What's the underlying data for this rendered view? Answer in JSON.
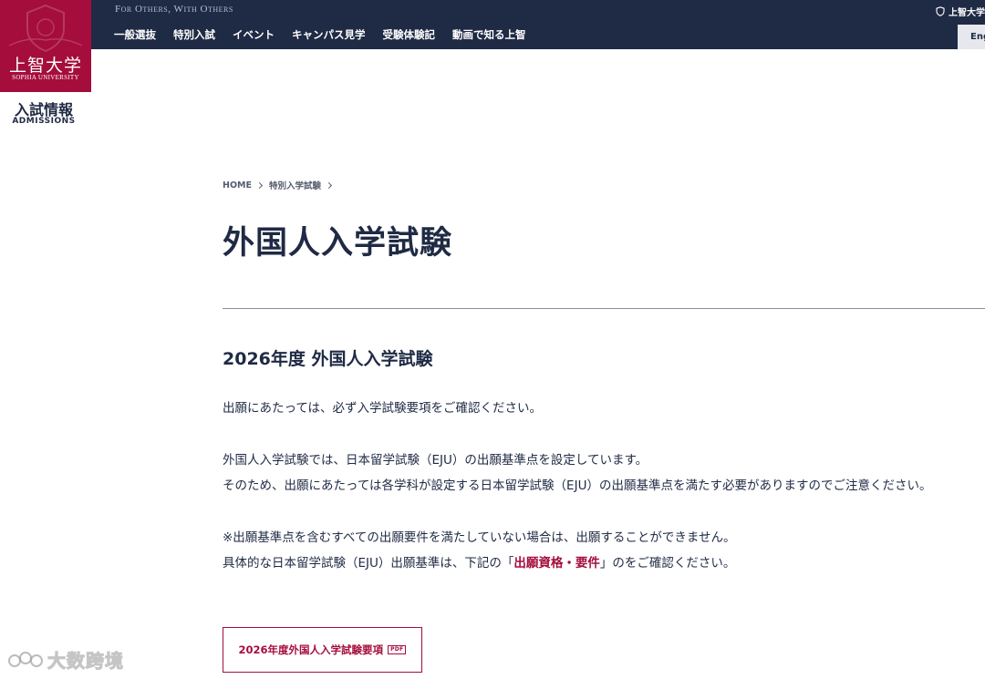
{
  "header": {
    "tagline": "For Others, With Others",
    "nav": [
      {
        "label": "一般選抜"
      },
      {
        "label": "特別入試"
      },
      {
        "label": "イベント"
      },
      {
        "label": "キャンパス見学"
      },
      {
        "label": "受験体験記"
      },
      {
        "label": "動画で知る上智"
      }
    ],
    "university_link": "上智大学",
    "language_button": "Eng"
  },
  "logo": {
    "kanji": "上智大学",
    "english": "SOPHIA UNIVERSITY",
    "section_jp": "入試情報",
    "section_en": "ADMISSIONS"
  },
  "breadcrumb": {
    "home": "HOME",
    "current": "特別入学試験"
  },
  "main": {
    "page_title": "外国人入学試験",
    "section_heading": "2026年度 外国人入学試験",
    "paragraph1": "出願にあたっては、必ず入学試験要項をご確認ください。",
    "paragraph2_line1": "外国人入学試験では、日本留学試験（EJU）の出願基準点を設定しています。",
    "paragraph2_line2": "そのため、出願にあたっては各学科が設定する日本留学試験（EJU）の出願基準点を満たす必要がありますのでご注意ください。",
    "paragraph3_line1": "※出願基準点を含むすべての出願要件を満たしていない場合は、出願することができません。",
    "paragraph3_line2_before": "具体的な日本留学試験（EJU）出願基準は、下記の「",
    "paragraph3_link": "出願資格・要件",
    "paragraph3_line2_after": "」のをご確認ください。",
    "guide_button": "2026年度外国人入学試験要項",
    "pdf_badge": "PDF"
  },
  "watermark": {
    "text": "大数跨境"
  },
  "colors": {
    "navy": "#1f2a44",
    "crimson": "#a50d3d"
  }
}
